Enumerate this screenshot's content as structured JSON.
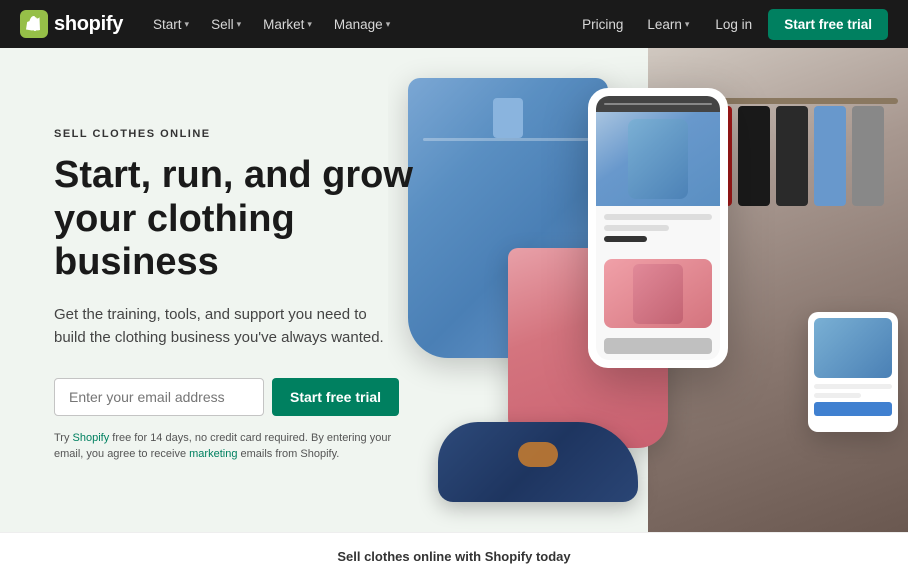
{
  "navbar": {
    "brand": "shopify",
    "nav_left": [
      {
        "label": "Start",
        "has_chevron": true,
        "id": "start"
      },
      {
        "label": "Sell",
        "has_chevron": true,
        "id": "sell"
      },
      {
        "label": "Market",
        "has_chevron": true,
        "id": "market"
      },
      {
        "label": "Manage",
        "has_chevron": true,
        "id": "manage"
      }
    ],
    "pricing_label": "Pricing",
    "learn_label": "Learn",
    "login_label": "Log in",
    "cta_label": "Start free trial"
  },
  "hero": {
    "eyebrow": "SELL CLOTHES ONLINE",
    "headline": "Start, run, and grow your clothing business",
    "subtext": "Get the training, tools, and support you need to build the clothing business you've always wanted.",
    "email_placeholder": "Enter your email address",
    "cta_label": "Start free trial",
    "disclaimer": "Try Shopify free for 14 days, no credit card required. By entering your email, you agree to receive marketing emails from Shopify."
  },
  "bottom_hint": {
    "text": "Sell clothes online with Shopify today"
  }
}
